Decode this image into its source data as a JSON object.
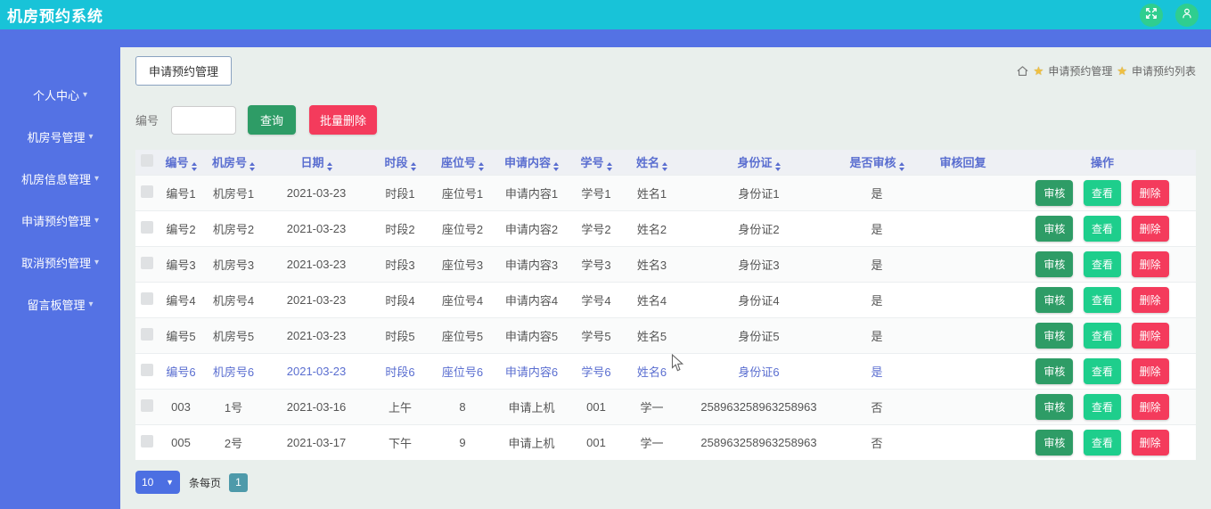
{
  "header": {
    "title": "机房预约系统"
  },
  "sidebar": {
    "items": [
      {
        "label": "个人中心"
      },
      {
        "label": "机房号管理"
      },
      {
        "label": "机房信息管理"
      },
      {
        "label": "申请预约管理"
      },
      {
        "label": "取消预约管理"
      },
      {
        "label": "留言板管理"
      }
    ]
  },
  "page": {
    "title": "申请预约管理",
    "breadcrumb": [
      "申请预约管理",
      "申请预约列表"
    ]
  },
  "search": {
    "label": "编号",
    "value": "",
    "query_button": "查询",
    "batch_delete_button": "批量删除"
  },
  "table": {
    "columns": [
      {
        "label": "编号",
        "sortable": true
      },
      {
        "label": "机房号",
        "sortable": true
      },
      {
        "label": "日期",
        "sortable": true
      },
      {
        "label": "时段",
        "sortable": true
      },
      {
        "label": "座位号",
        "sortable": true
      },
      {
        "label": "申请内容",
        "sortable": true
      },
      {
        "label": "学号",
        "sortable": true
      },
      {
        "label": "姓名",
        "sortable": true
      },
      {
        "label": "身份证",
        "sortable": true
      },
      {
        "label": "是否审核",
        "sortable": true
      },
      {
        "label": "审核回复",
        "sortable": false
      },
      {
        "label": "操作",
        "sortable": false
      }
    ],
    "actions": [
      "审核",
      "查看",
      "删除"
    ],
    "rows": [
      {
        "cells": [
          "编号1",
          "机房号1",
          "2021-03-23",
          "时段1",
          "座位号1",
          "申请内容1",
          "学号1",
          "姓名1",
          "身份证1",
          "是",
          ""
        ],
        "highlighted": false
      },
      {
        "cells": [
          "编号2",
          "机房号2",
          "2021-03-23",
          "时段2",
          "座位号2",
          "申请内容2",
          "学号2",
          "姓名2",
          "身份证2",
          "是",
          ""
        ],
        "highlighted": false
      },
      {
        "cells": [
          "编号3",
          "机房号3",
          "2021-03-23",
          "时段3",
          "座位号3",
          "申请内容3",
          "学号3",
          "姓名3",
          "身份证3",
          "是",
          ""
        ],
        "highlighted": false
      },
      {
        "cells": [
          "编号4",
          "机房号4",
          "2021-03-23",
          "时段4",
          "座位号4",
          "申请内容4",
          "学号4",
          "姓名4",
          "身份证4",
          "是",
          ""
        ],
        "highlighted": false
      },
      {
        "cells": [
          "编号5",
          "机房号5",
          "2021-03-23",
          "时段5",
          "座位号5",
          "申请内容5",
          "学号5",
          "姓名5",
          "身份证5",
          "是",
          ""
        ],
        "highlighted": false
      },
      {
        "cells": [
          "编号6",
          "机房号6",
          "2021-03-23",
          "时段6",
          "座位号6",
          "申请内容6",
          "学号6",
          "姓名6",
          "身份证6",
          "是",
          ""
        ],
        "highlighted": true
      },
      {
        "cells": [
          "003",
          "1号",
          "2021-03-16",
          "上午",
          "8",
          "申请上机",
          "001",
          "学一",
          "258963258963258963",
          "否",
          ""
        ],
        "highlighted": false
      },
      {
        "cells": [
          "005",
          "2号",
          "2021-03-17",
          "下午",
          "9",
          "申请上机",
          "001",
          "学一",
          "258963258963258963",
          "否",
          ""
        ],
        "highlighted": false
      }
    ]
  },
  "pagination": {
    "page_size": "10",
    "per_page_label": "条每页",
    "current_page": "1"
  },
  "colors": {
    "topbar_cyan": "#18c3d8",
    "sidebar_blue": "#5472e4",
    "button_green": "#2e9c66",
    "button_emerald": "#1ece8c",
    "button_red": "#f43b5c",
    "table_header_text": "#5a6ed0",
    "page_button_teal": "#4e9aaa",
    "star_gold": "#f0c040",
    "icon_circle_green": "#2fce8f"
  }
}
